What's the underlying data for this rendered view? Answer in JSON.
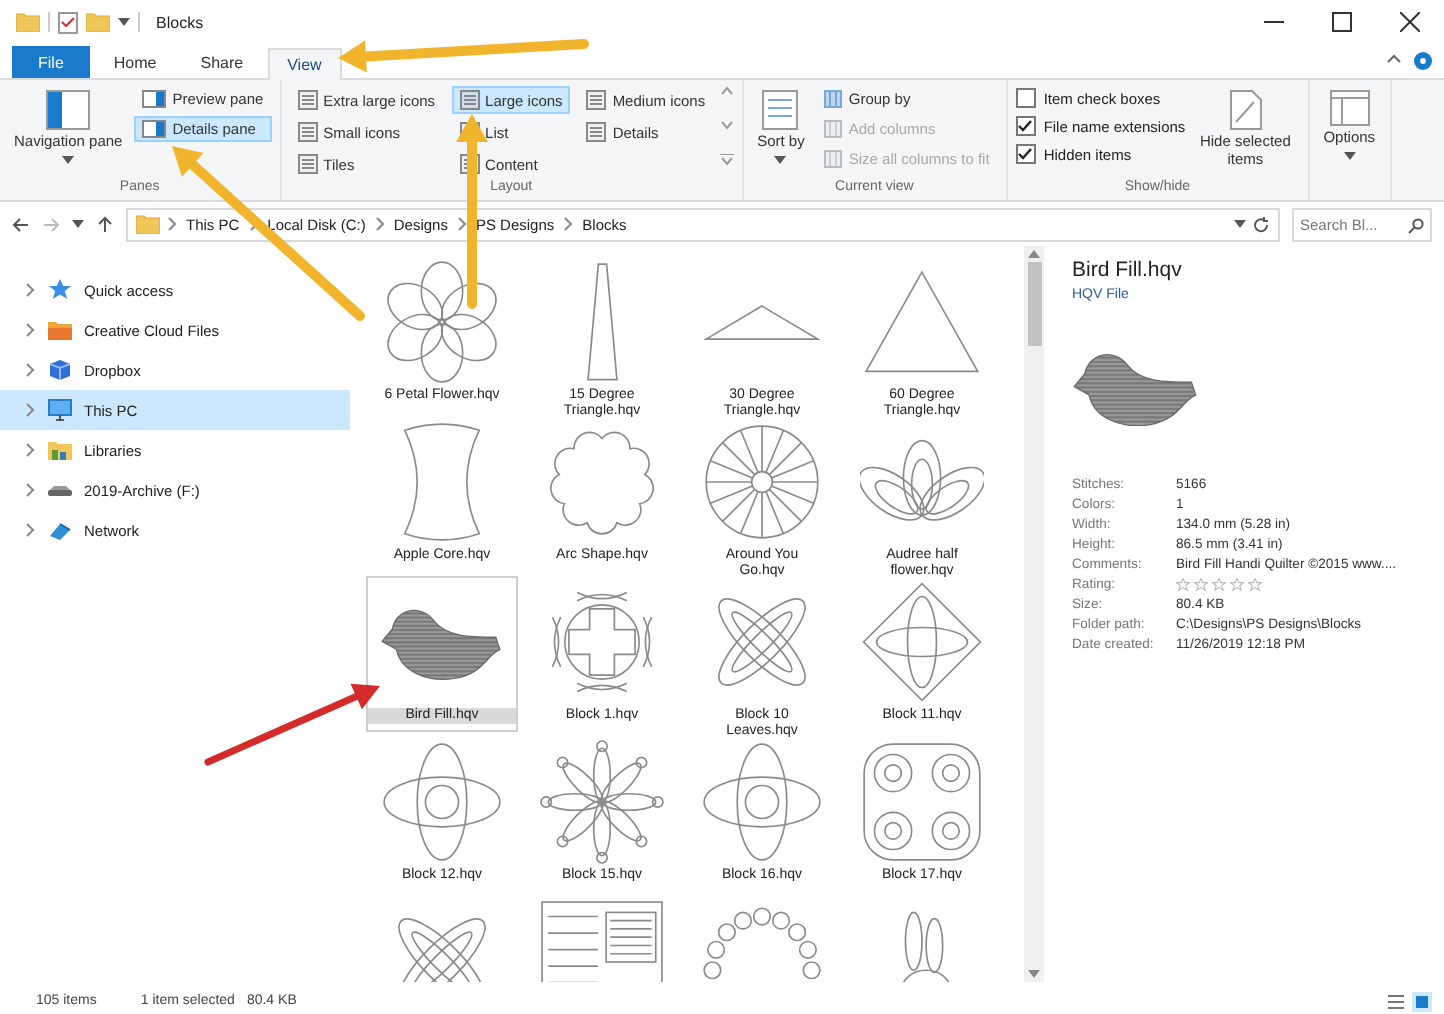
{
  "window": {
    "title": "Blocks"
  },
  "ribbon": {
    "tabs": [
      {
        "label": "File",
        "kind": "file",
        "selected": false
      },
      {
        "label": "Home",
        "kind": "plain",
        "selected": false
      },
      {
        "label": "Share",
        "kind": "plain",
        "selected": false
      },
      {
        "label": "View",
        "kind": "plain",
        "selected": true
      }
    ],
    "panes": {
      "title": "Panes",
      "navigation": {
        "label": "Navigation pane",
        "selected": false
      },
      "items": [
        {
          "label": "Preview pane",
          "selected": false
        },
        {
          "label": "Details pane",
          "selected": true
        }
      ]
    },
    "layout": {
      "title": "Layout",
      "items": [
        {
          "label": "Extra large icons",
          "selected": false
        },
        {
          "label": "Large icons",
          "selected": true
        },
        {
          "label": "Medium icons",
          "selected": false
        },
        {
          "label": "Small icons",
          "selected": false
        },
        {
          "label": "List",
          "selected": false
        },
        {
          "label": "Details",
          "selected": false
        },
        {
          "label": "Tiles",
          "selected": false
        },
        {
          "label": "Content",
          "selected": false
        }
      ]
    },
    "current_view": {
      "title": "Current view",
      "sort": {
        "label": "Sort by"
      },
      "items": [
        {
          "label": "Group by",
          "disabled": false
        },
        {
          "label": "Add columns",
          "disabled": true
        },
        {
          "label": "Size all columns to fit",
          "disabled": true
        }
      ]
    },
    "show_hide": {
      "title": "Show/hide",
      "checks": [
        {
          "label": "Item check boxes",
          "checked": false
        },
        {
          "label": "File name extensions",
          "checked": true
        },
        {
          "label": "Hidden items",
          "checked": true
        }
      ],
      "hide_button": {
        "label": "Hide selected items"
      }
    },
    "options": {
      "label": "Options"
    }
  },
  "address": {
    "path": [
      "This PC",
      "Local Disk (C:)",
      "Designs",
      "PS Designs",
      "Blocks"
    ],
    "search": {
      "placeholder": "Search Bl..."
    }
  },
  "navigation": [
    {
      "label": "Quick access",
      "kind": "star",
      "selected": false
    },
    {
      "label": "Creative Cloud Files",
      "kind": "cloud-folder",
      "selected": false
    },
    {
      "label": "Dropbox",
      "kind": "box",
      "selected": false
    },
    {
      "label": "This PC",
      "kind": "monitor",
      "selected": true
    },
    {
      "label": "Libraries",
      "kind": "library",
      "selected": false
    },
    {
      "label": "2019-Archive (F:)",
      "kind": "drive",
      "selected": false
    },
    {
      "label": "Network",
      "kind": "network",
      "selected": false
    }
  ],
  "files": [
    {
      "label": "6 Petal Flower.hqv",
      "kind": "flower",
      "selected": false
    },
    {
      "label": "15 Degree Triangle.hqv",
      "kind": "spike",
      "selected": false
    },
    {
      "label": "30 Degree Triangle.hqv",
      "kind": "flat-triangle",
      "selected": false
    },
    {
      "label": "60 Degree Triangle.hqv",
      "kind": "triangle",
      "selected": false
    },
    {
      "label": "Apple Core.hqv",
      "kind": "apple-core",
      "selected": false
    },
    {
      "label": "Arc Shape.hqv",
      "kind": "scallop",
      "selected": false
    },
    {
      "label": "Around You Go.hqv",
      "kind": "wheel",
      "selected": false
    },
    {
      "label": "Audree half flower.hqv",
      "kind": "fan",
      "selected": false
    },
    {
      "label": "Bird Fill.hqv",
      "kind": "bird",
      "selected": true
    },
    {
      "label": "Block 1.hqv",
      "kind": "knot",
      "selected": false
    },
    {
      "label": "Block 10 Leaves.hqv",
      "kind": "leaves",
      "selected": false
    },
    {
      "label": "Block 11.hqv",
      "kind": "square-petal",
      "selected": false
    },
    {
      "label": "Block 12.hqv",
      "kind": "flower4",
      "selected": false
    },
    {
      "label": "Block 15.hqv",
      "kind": "motif",
      "selected": false
    },
    {
      "label": "Block 16.hqv",
      "kind": "flower4",
      "selected": false
    },
    {
      "label": "Block 17.hqv",
      "kind": "swirl",
      "selected": false
    },
    {
      "kind": "leaves",
      "selected": false
    },
    {
      "kind": "lattice",
      "selected": false
    },
    {
      "kind": "arch",
      "selected": false
    },
    {
      "kind": "bunny",
      "selected": false
    }
  ],
  "details": {
    "title": "Bird Fill.hqv",
    "type": "HQV File",
    "properties": [
      {
        "label": "Stitches:",
        "value": "5166"
      },
      {
        "label": "Colors:",
        "value": "1"
      },
      {
        "label": "Width:",
        "value": "134.0 mm (5.28 in)"
      },
      {
        "label": "Height:",
        "value": "86.5 mm (3.41 in)"
      },
      {
        "label": "Comments:",
        "value": "Bird Fill Handi Quilter ©2015 www...."
      },
      {
        "label": "Rating:",
        "kind": "rating",
        "stars": 0
      },
      {
        "label": "Size:",
        "value": "80.4 KB"
      },
      {
        "label": "Folder path:",
        "value": "C:\\Designs\\PS Designs\\Blocks"
      },
      {
        "label": "Date created:",
        "value": "11/26/2019 12:18 PM"
      }
    ]
  },
  "status_bar": {
    "count": "105 items",
    "selection": "1 item selected",
    "size": "80.4 KB"
  }
}
